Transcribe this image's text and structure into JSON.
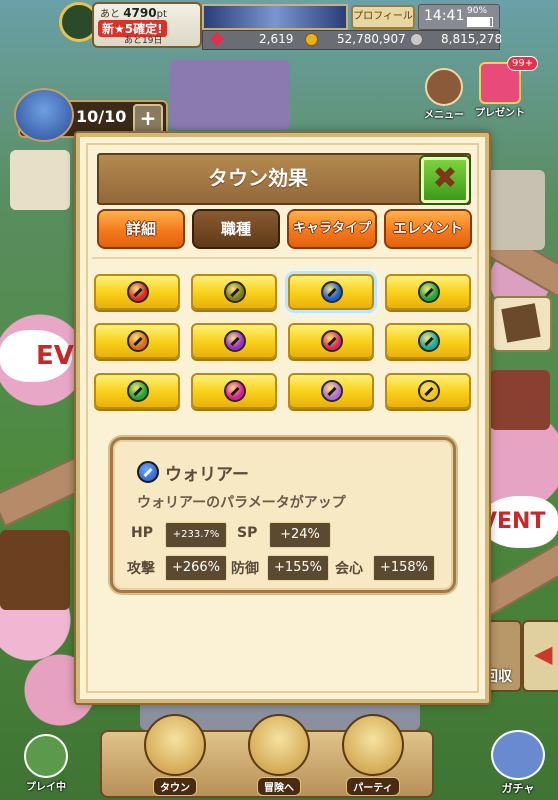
{
  "header": {
    "rank_prefix": "あと",
    "rank_points": "4790",
    "rank_suffix": "pt",
    "rank_promo": "新★5確定!",
    "rank_days": "あと19日",
    "profile_label": "プロフィール",
    "time": "14:41",
    "battery": "90%",
    "gems": "2,619",
    "coins": "52,780,907",
    "medals": "8,815,278"
  },
  "stamina": {
    "value": "10/10",
    "plus": "+"
  },
  "top_menu": {
    "menu": "メニュー",
    "present": "プレゼント",
    "present_badge": "99+"
  },
  "event_left": "EV",
  "event_right": "VENT",
  "side": {
    "collect": "回収",
    "arrow": "◀"
  },
  "modal": {
    "title": "タウン効果",
    "close": "✖",
    "tabs": [
      "詳細",
      "職種",
      "キャラタイプ",
      "エレメント"
    ],
    "active_tab": 1,
    "jobs": [
      {
        "color": "#d7282a",
        "selected": false
      },
      {
        "color": "#7a7a1a",
        "selected": false
      },
      {
        "color": "#1a5fd0",
        "selected": true
      },
      {
        "color": "#1aa83a",
        "selected": false
      },
      {
        "color": "#e0671a",
        "selected": false
      },
      {
        "color": "#9a2ad0",
        "selected": false
      },
      {
        "color": "#d82a5a",
        "selected": false
      },
      {
        "color": "#1aa8a0",
        "selected": false
      },
      {
        "color": "#1aa83a",
        "selected": false
      },
      {
        "color": "#d81a9a",
        "selected": false
      },
      {
        "color": "#b06ad8",
        "selected": false
      },
      {
        "color": "#f0c21a",
        "selected": false
      }
    ],
    "info": {
      "name": "ウォリアー",
      "description": "ウォリアーのパラメータがアップ",
      "hp_label": "HP",
      "hp_value": "+233.7%",
      "sp_label": "SP",
      "sp_value": "+24%",
      "atk_label": "攻撃",
      "atk_value": "+266%",
      "def_label": "防御",
      "def_value": "+155%",
      "crit_label": "会心",
      "crit_value": "+158%"
    }
  },
  "bottom_nav": {
    "playing": "プレイ中",
    "items": [
      "タウン",
      "冒険へ",
      "パーティ"
    ],
    "gacha": "ガチャ"
  }
}
